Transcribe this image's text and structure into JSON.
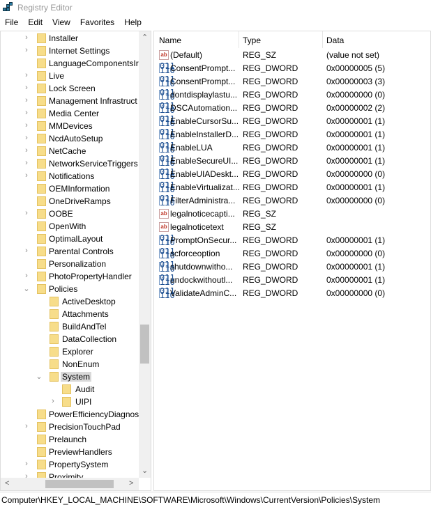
{
  "window": {
    "title": "Registry Editor"
  },
  "menu": [
    "File",
    "Edit",
    "View",
    "Favorites",
    "Help"
  ],
  "tree": [
    {
      "label": "Installer",
      "level": 1,
      "expander": "collapsed"
    },
    {
      "label": "Internet Settings",
      "level": 1,
      "expander": "collapsed"
    },
    {
      "label": "LanguageComponentsIr",
      "level": 1,
      "expander": "none"
    },
    {
      "label": "Live",
      "level": 1,
      "expander": "collapsed"
    },
    {
      "label": "Lock Screen",
      "level": 1,
      "expander": "collapsed"
    },
    {
      "label": "Management Infrastruct",
      "level": 1,
      "expander": "collapsed"
    },
    {
      "label": "Media Center",
      "level": 1,
      "expander": "collapsed"
    },
    {
      "label": "MMDevices",
      "level": 1,
      "expander": "collapsed"
    },
    {
      "label": "NcdAutoSetup",
      "level": 1,
      "expander": "collapsed"
    },
    {
      "label": "NetCache",
      "level": 1,
      "expander": "collapsed"
    },
    {
      "label": "NetworkServiceTriggers",
      "level": 1,
      "expander": "collapsed"
    },
    {
      "label": "Notifications",
      "level": 1,
      "expander": "collapsed"
    },
    {
      "label": "OEMInformation",
      "level": 1,
      "expander": "none"
    },
    {
      "label": "OneDriveRamps",
      "level": 1,
      "expander": "none"
    },
    {
      "label": "OOBE",
      "level": 1,
      "expander": "collapsed"
    },
    {
      "label": "OpenWith",
      "level": 1,
      "expander": "none"
    },
    {
      "label": "OptimalLayout",
      "level": 1,
      "expander": "none"
    },
    {
      "label": "Parental Controls",
      "level": 1,
      "expander": "collapsed"
    },
    {
      "label": "Personalization",
      "level": 1,
      "expander": "none"
    },
    {
      "label": "PhotoPropertyHandler",
      "level": 1,
      "expander": "collapsed"
    },
    {
      "label": "Policies",
      "level": 1,
      "expander": "expanded"
    },
    {
      "label": "ActiveDesktop",
      "level": 2,
      "expander": "none"
    },
    {
      "label": "Attachments",
      "level": 2,
      "expander": "none"
    },
    {
      "label": "BuildAndTel",
      "level": 2,
      "expander": "none"
    },
    {
      "label": "DataCollection",
      "level": 2,
      "expander": "none"
    },
    {
      "label": "Explorer",
      "level": 2,
      "expander": "none"
    },
    {
      "label": "NonEnum",
      "level": 2,
      "expander": "none"
    },
    {
      "label": "System",
      "level": 2,
      "expander": "expanded",
      "selected": true
    },
    {
      "label": "Audit",
      "level": 3,
      "expander": "none"
    },
    {
      "label": "UIPI",
      "level": 3,
      "expander": "collapsed"
    },
    {
      "label": "PowerEfficiencyDiagnos",
      "level": 1,
      "expander": "none"
    },
    {
      "label": "PrecisionTouchPad",
      "level": 1,
      "expander": "collapsed"
    },
    {
      "label": "Prelaunch",
      "level": 1,
      "expander": "none"
    },
    {
      "label": "PreviewHandlers",
      "level": 1,
      "expander": "none"
    },
    {
      "label": "PropertySystem",
      "level": 1,
      "expander": "collapsed"
    },
    {
      "label": "Proximity",
      "level": 1,
      "expander": "collapsed"
    }
  ],
  "columns": {
    "name": "Name",
    "type": "Type",
    "data": "Data"
  },
  "values": [
    {
      "icon": "string-value-icon",
      "name": "(Default)",
      "type": "REG_SZ",
      "data": "(value not set)"
    },
    {
      "icon": "binary-value-icon",
      "name": "ConsentPrompt...",
      "type": "REG_DWORD",
      "data": "0x00000005 (5)"
    },
    {
      "icon": "binary-value-icon",
      "name": "ConsentPrompt...",
      "type": "REG_DWORD",
      "data": "0x00000003 (3)"
    },
    {
      "icon": "binary-value-icon",
      "name": "dontdisplaylastu...",
      "type": "REG_DWORD",
      "data": "0x00000000 (0)"
    },
    {
      "icon": "binary-value-icon",
      "name": "DSCAutomation...",
      "type": "REG_DWORD",
      "data": "0x00000002 (2)"
    },
    {
      "icon": "binary-value-icon",
      "name": "EnableCursorSu...",
      "type": "REG_DWORD",
      "data": "0x00000001 (1)"
    },
    {
      "icon": "binary-value-icon",
      "name": "EnableInstallerD...",
      "type": "REG_DWORD",
      "data": "0x00000001 (1)"
    },
    {
      "icon": "binary-value-icon",
      "name": "EnableLUA",
      "type": "REG_DWORD",
      "data": "0x00000001 (1)"
    },
    {
      "icon": "binary-value-icon",
      "name": "EnableSecureUI...",
      "type": "REG_DWORD",
      "data": "0x00000001 (1)"
    },
    {
      "icon": "binary-value-icon",
      "name": "EnableUIADeskt...",
      "type": "REG_DWORD",
      "data": "0x00000000 (0)"
    },
    {
      "icon": "binary-value-icon",
      "name": "EnableVirtualizat...",
      "type": "REG_DWORD",
      "data": "0x00000001 (1)"
    },
    {
      "icon": "binary-value-icon",
      "name": "FilterAdministra...",
      "type": "REG_DWORD",
      "data": "0x00000000 (0)"
    },
    {
      "icon": "string-value-icon",
      "name": "legalnoticecapti...",
      "type": "REG_SZ",
      "data": ""
    },
    {
      "icon": "string-value-icon",
      "name": "legalnoticetext",
      "type": "REG_SZ",
      "data": ""
    },
    {
      "icon": "binary-value-icon",
      "name": "PromptOnSecur...",
      "type": "REG_DWORD",
      "data": "0x00000001 (1)"
    },
    {
      "icon": "binary-value-icon",
      "name": "scforceoption",
      "type": "REG_DWORD",
      "data": "0x00000000 (0)"
    },
    {
      "icon": "binary-value-icon",
      "name": "shutdownwitho...",
      "type": "REG_DWORD",
      "data": "0x00000001 (1)"
    },
    {
      "icon": "binary-value-icon",
      "name": "undockwithoutl...",
      "type": "REG_DWORD",
      "data": "0x00000001 (1)"
    },
    {
      "icon": "binary-value-icon",
      "name": "ValidateAdminC...",
      "type": "REG_DWORD",
      "data": "0x00000000 (0)"
    }
  ],
  "status": {
    "path": "Computer\\HKEY_LOCAL_MACHINE\\SOFTWARE\\Microsoft\\Windows\\CurrentVersion\\Policies\\System"
  }
}
